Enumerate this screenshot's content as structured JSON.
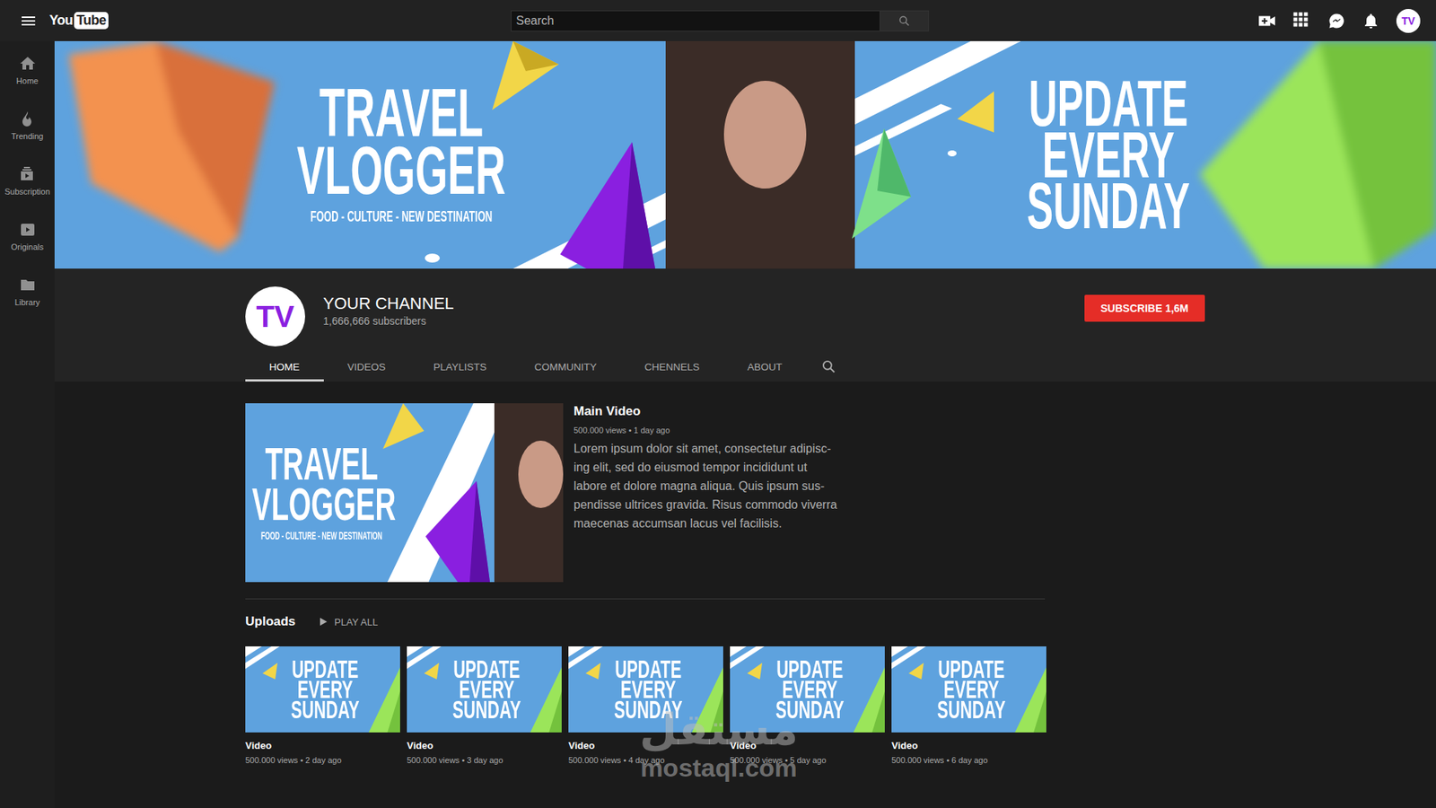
{
  "topbar": {
    "logo": {
      "you": "You",
      "tube": "Tube"
    },
    "search": {
      "placeholder": "Search"
    },
    "avatar": "TV"
  },
  "sidebar": {
    "items": [
      {
        "label": "Home",
        "selected": false
      },
      {
        "label": "Trending",
        "selected": false
      },
      {
        "label": "Subscription",
        "selected": false
      },
      {
        "label": "Originals",
        "selected": false
      },
      {
        "label": "Library",
        "selected": false
      }
    ]
  },
  "banner": {
    "title_lines": [
      "TRAVEL",
      "VLOGGER"
    ],
    "tagline": "FOOD - CULTURE - NEW DESTINATION",
    "schedule_lines": [
      "UPDATE",
      "EVERY",
      "SUNDAY"
    ]
  },
  "channel": {
    "avatar": "TV",
    "name": "YOUR CHANNEL",
    "subscribers": "1,666,666 subscribers",
    "subscribe_button": "SUBSCRIBE 1,6M"
  },
  "tabs": [
    {
      "label": "HOME",
      "selected": true
    },
    {
      "label": "VIDEOS",
      "selected": false
    },
    {
      "label": "PLAYLISTS",
      "selected": false
    },
    {
      "label": "COMMUNITY",
      "selected": false
    },
    {
      "label": "CHENNELS",
      "selected": false
    },
    {
      "label": "ABOUT",
      "selected": false
    }
  ],
  "featured": {
    "thumbnail": {
      "title_lines": [
        "TRAVEL",
        "VLOGGER"
      ],
      "tagline": "FOOD - CULTURE - NEW DESTINATION"
    },
    "title": "Main Video",
    "meta": "500.000 views • 1 day ago",
    "description_lines": [
      "Lorem ipsum dolor sit amet, consectetur adipisc-",
      "ing elit, sed do eiusmod tempor incididunt ut",
      "labore et dolore magna aliqua. Quis ipsum sus-",
      "pendisse ultrices gravida. Risus commodo viverra",
      "maecenas accumsan lacus vel facilisis."
    ]
  },
  "uploads": {
    "title": "Uploads",
    "play_all": "PLAY ALL",
    "items": [
      {
        "thumbnail_lines": [
          "UPDATE",
          "EVERY",
          "SUNDAY"
        ],
        "title": "Video",
        "meta": "500.000 views • 2 day ago"
      },
      {
        "thumbnail_lines": [
          "UPDATE",
          "EVERY",
          "SUNDAY"
        ],
        "title": "Video",
        "meta": "500.000 views • 3 day ago"
      },
      {
        "thumbnail_lines": [
          "UPDATE",
          "EVERY",
          "SUNDAY"
        ],
        "title": "Video",
        "meta": "500.000 views • 4 day ago"
      },
      {
        "thumbnail_lines": [
          "UPDATE",
          "EVERY",
          "SUNDAY"
        ],
        "title": "Video",
        "meta": "500.000 views • 5 day ago"
      },
      {
        "thumbnail_lines": [
          "UPDATE",
          "EVERY",
          "SUNDAY"
        ],
        "title": "Video",
        "meta": "500.000 views • 6 day ago"
      }
    ]
  },
  "watermark": {
    "script": "مستقل",
    "site": "mostaql.com"
  }
}
